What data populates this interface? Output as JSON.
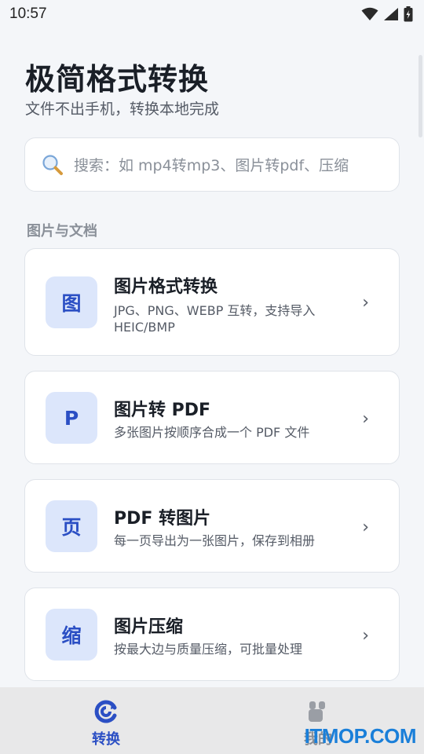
{
  "status_bar": {
    "time": "10:57"
  },
  "header": {
    "title": "极简格式转换",
    "subtitle": "文件不出手机，转换本地完成"
  },
  "search": {
    "placeholder": "搜索：如 mp4转mp3、图片转pdf、压缩",
    "icon": "search-icon"
  },
  "section": {
    "label": "图片与文档"
  },
  "cards": [
    {
      "icon_char": "图",
      "title": "图片格式转换",
      "desc": "JPG、PNG、WEBP 互转，支持导入 HEIC/BMP",
      "chevron": "›"
    },
    {
      "icon_char": "P",
      "title": "图片转 PDF",
      "desc": "多张图片按顺序合成一个 PDF 文件",
      "chevron": "›"
    },
    {
      "icon_char": "页",
      "title": "PDF 转图片",
      "desc": "每一页导出为一张图片，保存到相册",
      "chevron": "›"
    },
    {
      "icon_char": "缩",
      "title": "图片压缩",
      "desc": "按最大边与质量压缩，可批量处理",
      "chevron": "›"
    }
  ],
  "bottom_nav": [
    {
      "label": "转换",
      "icon": "convert-icon",
      "active": true
    },
    {
      "label": "我的",
      "icon": "profile-icon",
      "active": false
    }
  ],
  "watermark": {
    "text": "ITMOP.COM"
  },
  "colors": {
    "accent": "#2b4fc4",
    "icon_bg": "#dce6fb",
    "background": "#f4f6f9"
  }
}
